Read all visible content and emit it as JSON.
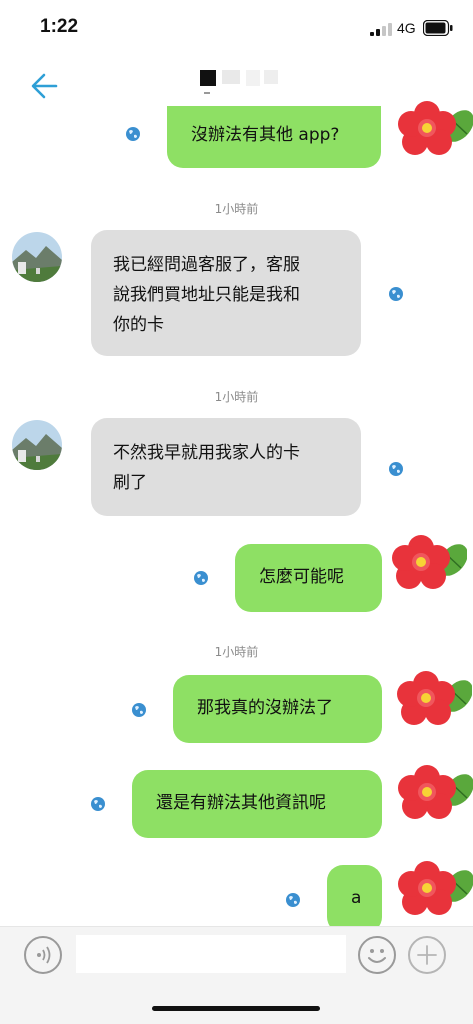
{
  "status_bar": {
    "time": "1:22",
    "network": "4G"
  },
  "header": {
    "back_icon": "arrow-left-icon",
    "accent_color": "#2e9fd6"
  },
  "messages": [
    {
      "direction": "outgoing",
      "text": "沒辦法有其他 app?"
    },
    {
      "type": "timestamp",
      "text": "1小時前"
    },
    {
      "direction": "incoming",
      "text": "我已經問過客服了，客服\n說我們買地址只能是我和\n你的卡"
    },
    {
      "type": "timestamp",
      "text": "1小時前"
    },
    {
      "direction": "incoming",
      "text": "不然我早就用我家人的卡\n刷了"
    },
    {
      "direction": "outgoing",
      "text": "怎麼可能呢"
    },
    {
      "type": "timestamp",
      "text": "1小時前"
    },
    {
      "direction": "outgoing",
      "text": "那我真的沒辦法了"
    },
    {
      "direction": "outgoing",
      "text": "還是有辦法其他資訊呢"
    },
    {
      "direction": "outgoing",
      "text": "a"
    }
  ],
  "colors": {
    "outgoing_bubble": "#8ee064",
    "incoming_bubble": "#dedede",
    "flower": "#e8333b"
  },
  "input_bar": {
    "placeholder": "",
    "value": ""
  }
}
